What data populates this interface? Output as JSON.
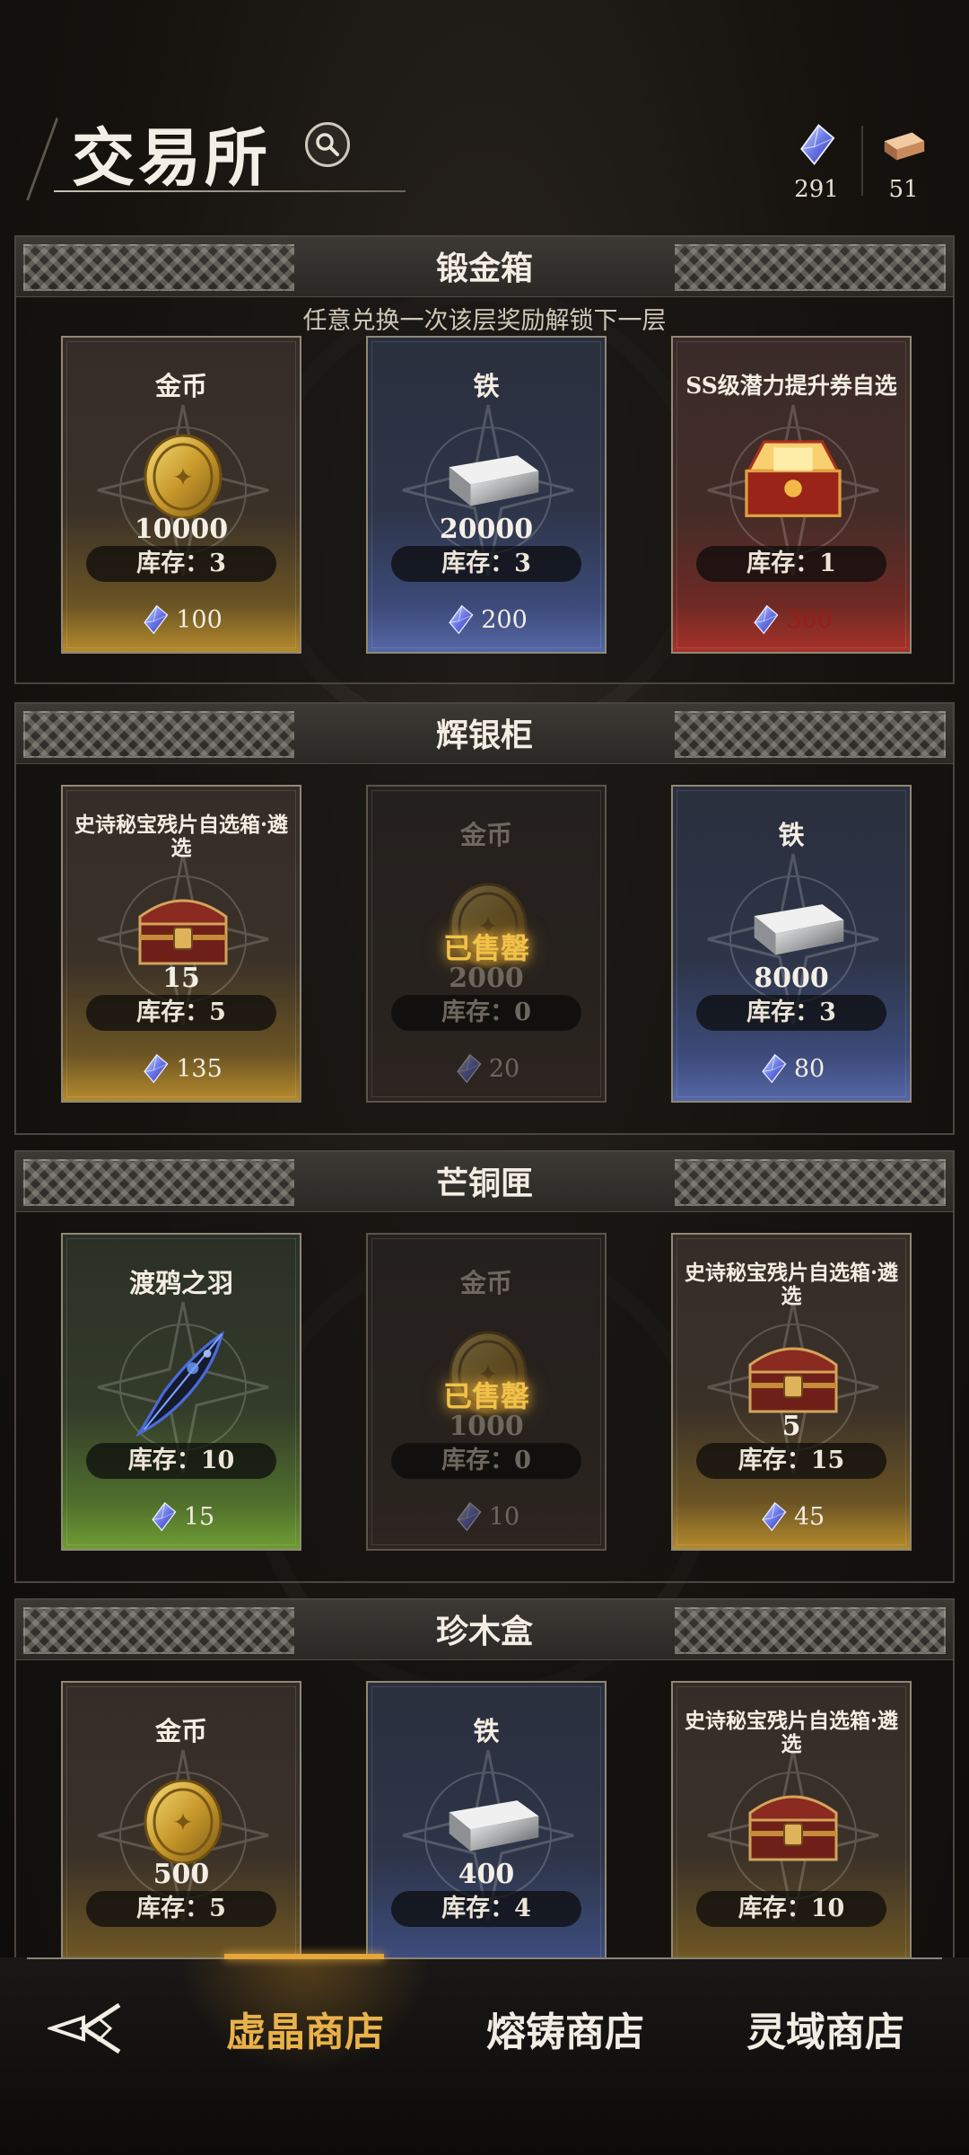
{
  "header": {
    "title": "交易所",
    "search_icon": "search-icon",
    "currencies": [
      {
        "icon": "crystal-icon",
        "value": "291"
      },
      {
        "icon": "ingot-icon",
        "value": "51"
      }
    ]
  },
  "sections": [
    {
      "title": "锻金箱",
      "subtitle": "任意兑换一次该层奖励解锁下一层",
      "cards": [
        {
          "name": "金币",
          "icon": "gold-coin-icon",
          "amount": "10000",
          "stock": "库存：3",
          "price": "100"
        },
        {
          "name": "铁",
          "icon": "iron-ingot-icon",
          "amount": "20000",
          "stock": "库存：3",
          "price": "200"
        },
        {
          "name": "SS级潜力提升券自选",
          "icon": "treasure-chest-icon",
          "amount": "",
          "stock": "库存：1",
          "price": "300"
        }
      ]
    },
    {
      "title": "辉银柜",
      "cards": [
        {
          "name": "史诗秘宝残片自选箱·遴选",
          "icon": "chest-icon",
          "amount": "15",
          "stock": "库存：5",
          "price": "135"
        },
        {
          "name": "金币",
          "icon": "gold-coin-icon",
          "amount": "2000",
          "stock": "库存：0",
          "price": "20",
          "status": "已售罄"
        },
        {
          "name": "铁",
          "icon": "iron-ingot-icon",
          "amount": "8000",
          "stock": "库存：3",
          "price": "80"
        }
      ]
    },
    {
      "title": "芒铜匣",
      "cards": [
        {
          "name": "渡鸦之羽",
          "icon": "raven-feather-icon",
          "amount": "",
          "stock": "库存：10",
          "price": "15"
        },
        {
          "name": "金币",
          "icon": "gold-coin-icon",
          "amount": "1000",
          "stock": "库存：0",
          "price": "10",
          "status": "已售罄"
        },
        {
          "name": "史诗秘宝残片自选箱·遴选",
          "icon": "chest-icon",
          "amount": "5",
          "stock": "库存：15",
          "price": "45"
        }
      ]
    },
    {
      "title": "珍木盒",
      "cards": [
        {
          "name": "金币",
          "icon": "gold-coin-icon",
          "amount": "500",
          "stock": "库存：5",
          "price": ""
        },
        {
          "name": "铁",
          "icon": "iron-ingot-icon",
          "amount": "400",
          "stock": "库存：4",
          "price": ""
        },
        {
          "name": "史诗秘宝残片自选箱·遴选",
          "icon": "chest-icon",
          "amount": "",
          "stock": "库存：10",
          "price": ""
        }
      ]
    }
  ],
  "bottom_nav": {
    "back_icon": "back-arrow-icon",
    "tabs": [
      {
        "label": "虚晶商店",
        "active": true
      },
      {
        "label": "熔铸商店",
        "active": false
      },
      {
        "label": "灵域商店",
        "active": false
      }
    ]
  },
  "colors": {
    "accent": "#e9b24a",
    "soldout": "#f1c24a",
    "price_insufficient": "#9b1c1a"
  }
}
